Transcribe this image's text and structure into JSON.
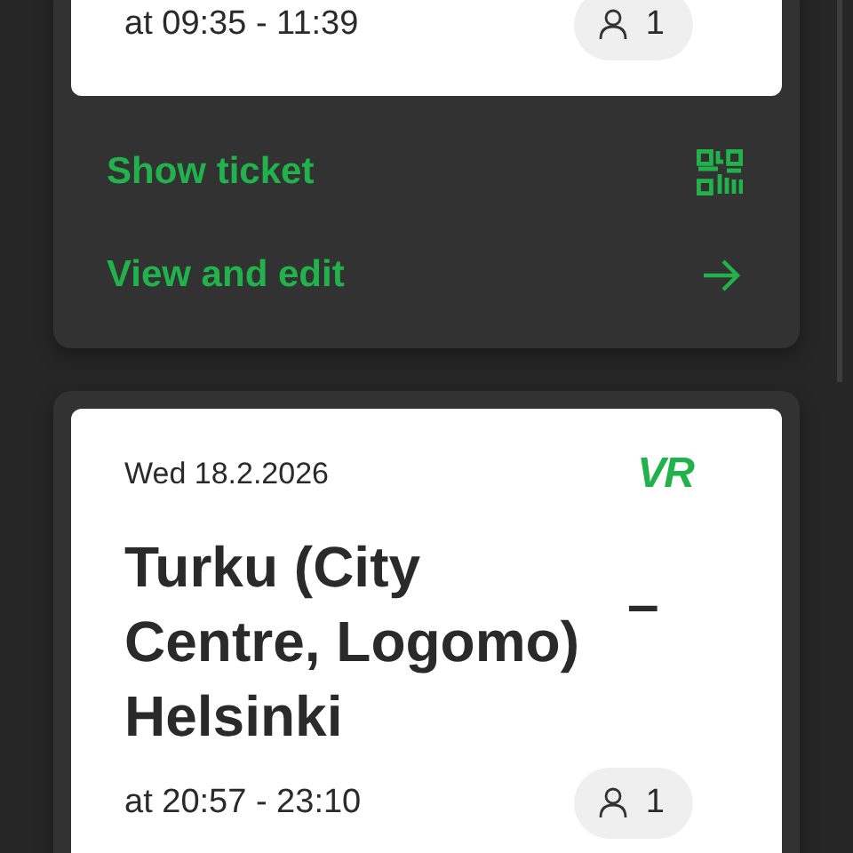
{
  "trips": [
    {
      "time": "at 09:35 - 11:39",
      "passengers": "1",
      "actions": [
        {
          "label": "Show ticket",
          "kind": "qr"
        },
        {
          "label": "View and edit",
          "kind": "arrow"
        }
      ]
    },
    {
      "date": "Wed 18.2.2026",
      "logo": "VR",
      "origin": "Turku (City Centre, Logomo)",
      "separator": "–",
      "destination": "Helsinki",
      "time": "at 20:57 - 23:10",
      "passengers": "1"
    }
  ]
}
